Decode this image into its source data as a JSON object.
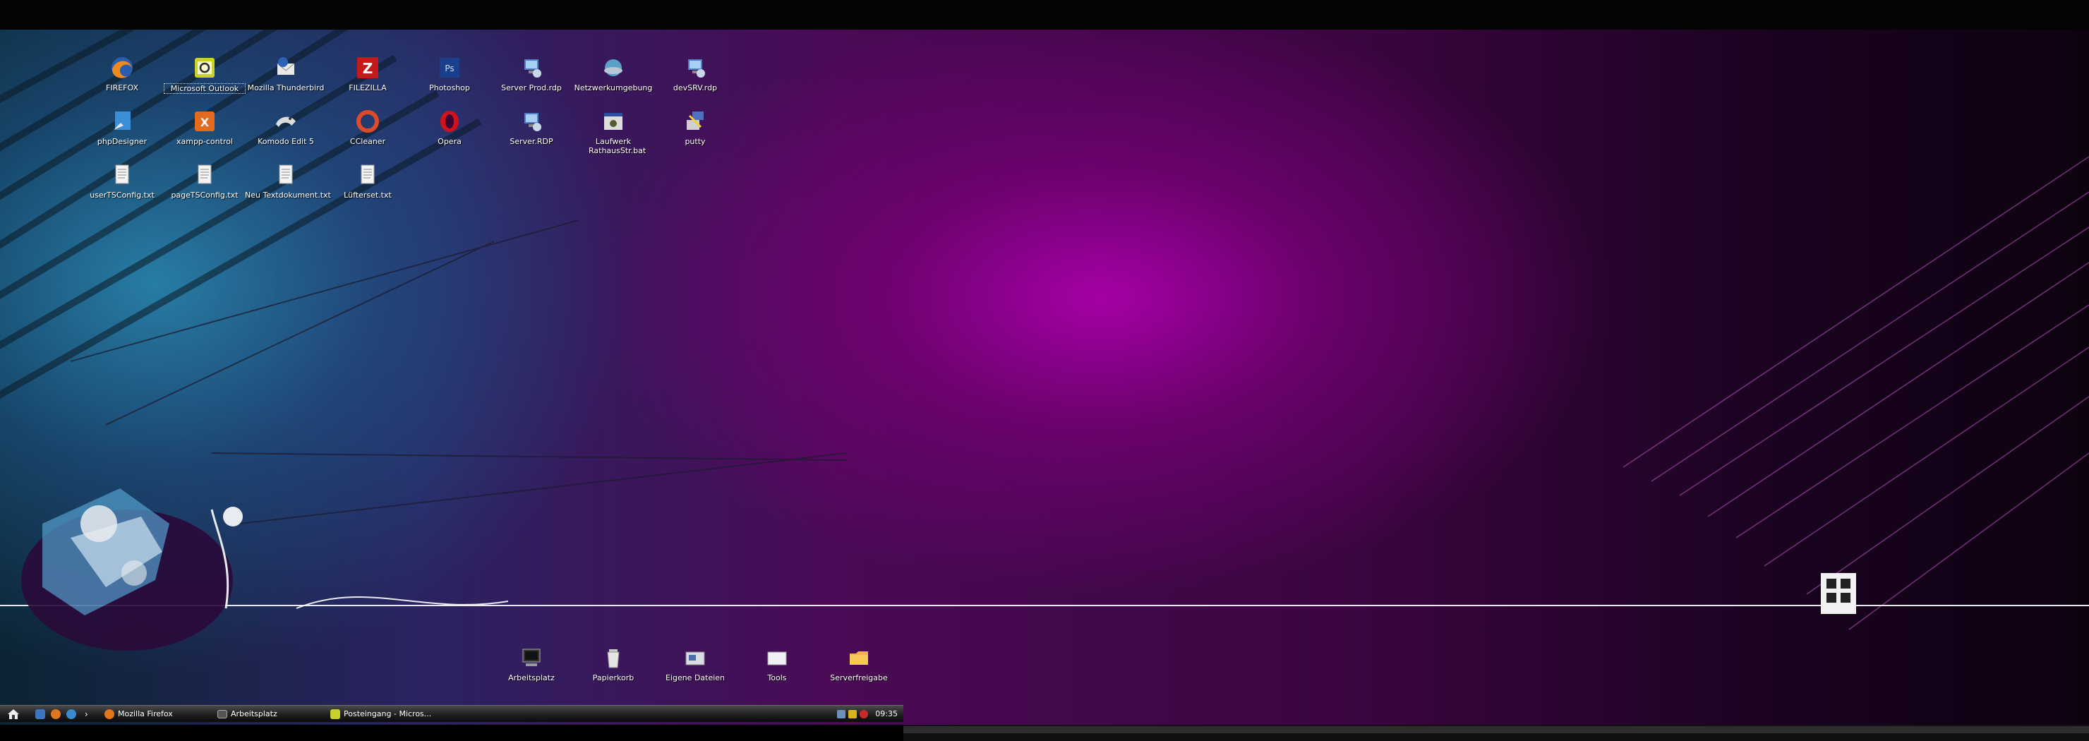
{
  "desktop_icons": {
    "row1": [
      {
        "label": "FIREFOX",
        "icon": "firefox-icon"
      },
      {
        "label": "Microsoft Outlook",
        "icon": "outlook-icon"
      },
      {
        "label": "Mozilla Thunderbird",
        "icon": "thunderbird-icon"
      },
      {
        "label": "FILEZILLA",
        "icon": "filezilla-icon"
      },
      {
        "label": "Photoshop",
        "icon": "photoshop-icon"
      },
      {
        "label": "Server Prod.rdp",
        "icon": "rdp-icon"
      },
      {
        "label": "Netzwerkumgebung",
        "icon": "network-icon"
      },
      {
        "label": "devSRV.rdp",
        "icon": "rdp-icon"
      }
    ],
    "row2": [
      {
        "label": "phpDesigner",
        "icon": "phpdesigner-icon"
      },
      {
        "label": "xampp-control",
        "icon": "xampp-icon"
      },
      {
        "label": "Komodo Edit 5",
        "icon": "komodo-icon"
      },
      {
        "label": "CCleaner",
        "icon": "ccleaner-icon"
      },
      {
        "label": "Opera",
        "icon": "opera-icon"
      },
      {
        "label": "Server.RDP",
        "icon": "rdp-icon"
      },
      {
        "label": "Laufwerk RathausStr.bat",
        "icon": "batch-icon"
      },
      {
        "label": "putty",
        "icon": "putty-icon"
      }
    ],
    "row3": [
      {
        "label": "userTSConfig.txt",
        "icon": "text-file-icon"
      },
      {
        "label": "pageTSConfig.txt",
        "icon": "text-file-icon"
      },
      {
        "label": "Neu Textdokument.txt",
        "icon": "text-file-icon"
      },
      {
        "label": "Lüfterset.txt",
        "icon": "text-file-icon"
      }
    ],
    "dock": [
      {
        "label": "Arbeitsplatz",
        "icon": "computer-icon"
      },
      {
        "label": "Papierkorb",
        "icon": "recycle-bin-icon"
      },
      {
        "label": "Eigene Dateien",
        "icon": "my-documents-icon"
      },
      {
        "label": "Tools",
        "icon": "tools-folder-icon"
      },
      {
        "label": "Serverfreigabe",
        "icon": "shared-folder-icon"
      }
    ]
  },
  "taskbar": {
    "tasks": [
      {
        "label": "Mozilla Firefox",
        "icon": "firefox-icon"
      },
      {
        "label": "Arbeitsplatz",
        "icon": "computer-icon"
      },
      {
        "label": "Posteingang - Micros...",
        "icon": "outlook-icon"
      }
    ],
    "clock": "09:35"
  },
  "colors": {
    "accent_magenta": "#a000a8",
    "accent_teal": "#2a8aaa",
    "taskbar": "#1e1e1e"
  }
}
